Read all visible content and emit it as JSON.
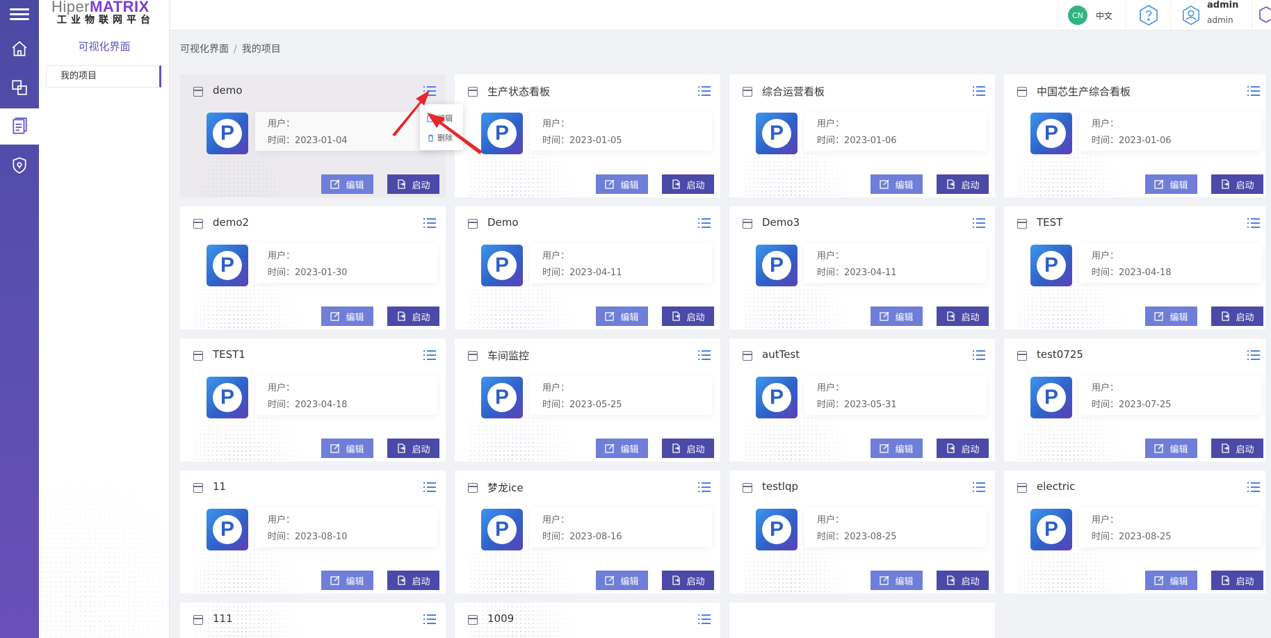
{
  "app": {
    "logo_top": "Hiper",
    "logo_brand": "MATRIX",
    "logo_sub": "工业物联网平台"
  },
  "sidebar": {
    "section_title": "可视化界面",
    "menu_item": "我的项目"
  },
  "header": {
    "lang_badge": "CN",
    "lang_label": "中文",
    "user_name": "admin",
    "user_role": "admin"
  },
  "breadcrumb": {
    "parent": "可视化界面",
    "separator": "/",
    "current": "我的项目"
  },
  "labels": {
    "user_prefix": "用户：",
    "time_prefix": "时间：",
    "edit_button": "编辑",
    "start_button": "启动"
  },
  "popup_menu": {
    "edit": "编辑",
    "delete": "删除"
  },
  "projects": [
    {
      "name": "demo",
      "date": "2023-01-04"
    },
    {
      "name": "生产状态看板",
      "date": "2023-01-05"
    },
    {
      "name": "综合运营看板",
      "date": "2023-01-06"
    },
    {
      "name": "中国芯生产综合看板",
      "date": "2023-01-06"
    },
    {
      "name": "demo2",
      "date": "2023-01-30"
    },
    {
      "name": "Demo",
      "date": "2023-04-11"
    },
    {
      "name": "Demo3",
      "date": "2023-04-11"
    },
    {
      "name": "TEST",
      "date": "2023-04-18"
    },
    {
      "name": "TEST1",
      "date": "2023-04-18"
    },
    {
      "name": "车间监控",
      "date": "2023-05-25"
    },
    {
      "name": "autTest",
      "date": "2023-05-31"
    },
    {
      "name": "test0725",
      "date": "2023-07-25"
    },
    {
      "name": "11",
      "date": "2023-08-10"
    },
    {
      "name": "梦龙ice",
      "date": "2023-08-16"
    },
    {
      "name": "testlqp",
      "date": "2023-08-25"
    },
    {
      "name": "electric",
      "date": "2023-08-25"
    },
    {
      "name": "111",
      "date": ""
    },
    {
      "name": "1009",
      "date": ""
    }
  ]
}
